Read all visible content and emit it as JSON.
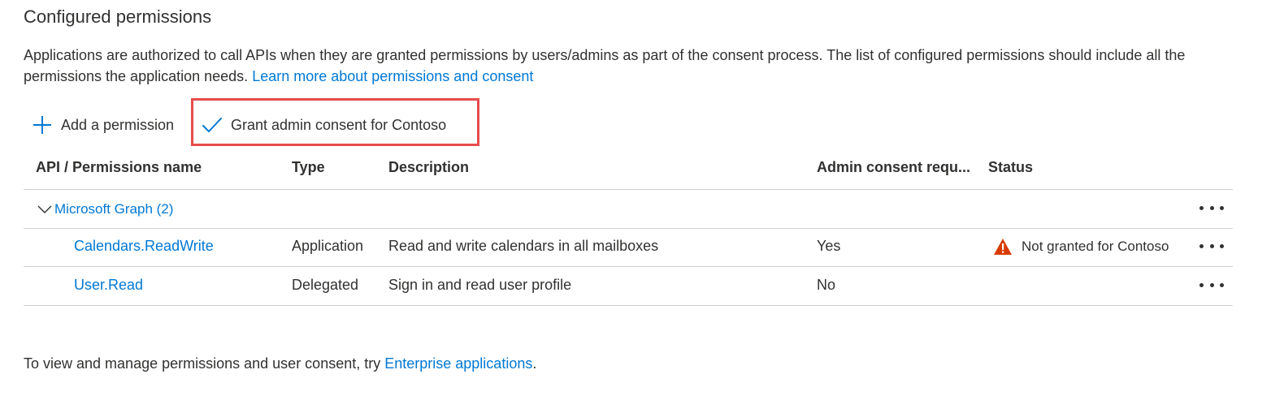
{
  "section": {
    "title": "Configured permissions",
    "description": "Applications are authorized to call APIs when they are granted permissions by users/admins as part of the consent process. The list of configured permissions should include all the permissions the application needs.",
    "learn_more_link": "Learn more about permissions and consent"
  },
  "toolbar": {
    "add_label": "Add a permission",
    "add_icon": "plus-icon",
    "grant_label": "Grant admin consent for Contoso",
    "grant_icon": "checkmark-icon",
    "highlight_color": "#e74c4c"
  },
  "table": {
    "columns": [
      "API / Permissions name",
      "Type",
      "Description",
      "Admin consent requ...",
      "Status"
    ],
    "group": {
      "label": "Microsoft Graph (2)",
      "icon": "chevron-down-icon"
    },
    "rows": [
      {
        "name": "Calendars.ReadWrite",
        "type": "Application",
        "description": "Read and write calendars in all mailboxes",
        "admin_consent": "Yes",
        "status": "Not granted for Contoso",
        "status_icon": "warning-icon",
        "status_color": "#d83b01"
      },
      {
        "name": "User.Read",
        "type": "Delegated",
        "description": "Sign in and read user profile",
        "admin_consent": "No",
        "status": ""
      }
    ]
  },
  "footer": {
    "prefix": "To view and manage permissions and user consent, try ",
    "link": "Enterprise applications",
    "suffix": "."
  },
  "colors": {
    "link": "#0078d4",
    "text": "#323130",
    "divider": "#d2d2d2"
  }
}
